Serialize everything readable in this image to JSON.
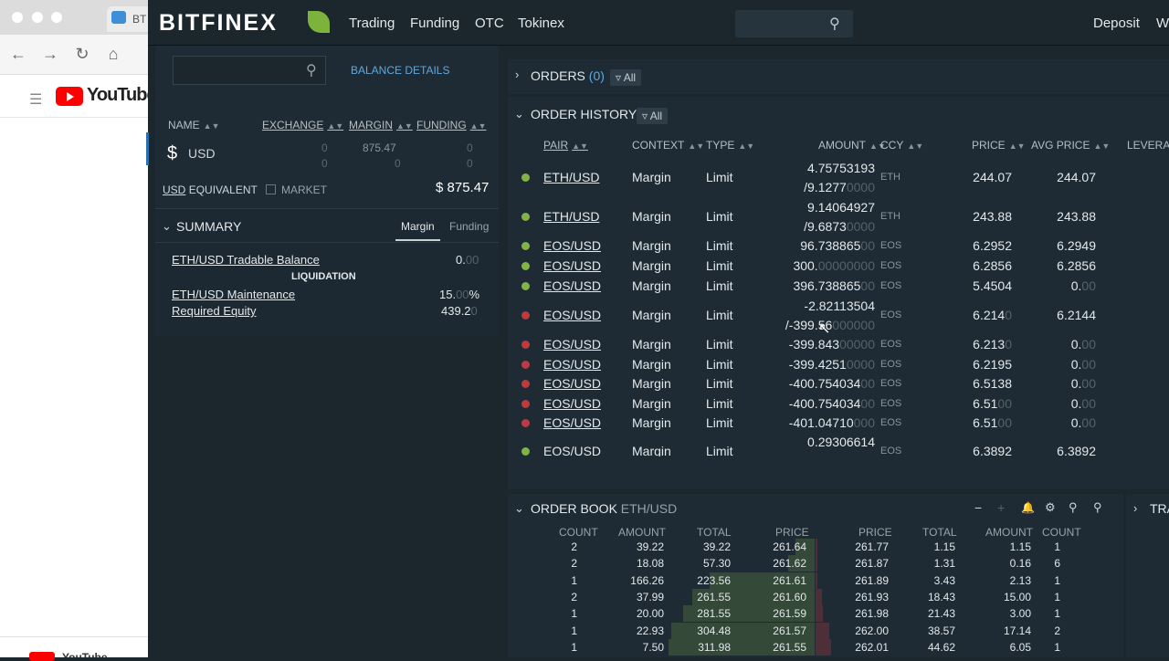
{
  "browser": {
    "tab_title": "BT",
    "youtube_word": "YouTube",
    "dock_label": "YouTube"
  },
  "nav": {
    "brand": "BITFINEX",
    "items": [
      "Trading",
      "Funding",
      "OTC",
      "Tokinex"
    ],
    "deposit": "Deposit",
    "w": "W"
  },
  "balance": {
    "details_link": "BALANCE DETAILS",
    "columns": [
      "NAME",
      "EXCHANGE",
      "MARGIN",
      "FUNDING"
    ],
    "row": {
      "symbol": "$",
      "currency": "USD",
      "exchange_top": "0",
      "exchange_bottom": "0",
      "margin_top": "875.47",
      "margin_bottom": "0",
      "funding_top": "0",
      "funding_bottom": "0"
    },
    "equivalent_currency": "USD",
    "equivalent_label": "EQUIVALENT",
    "market_label": "MARKET",
    "total": "$ 875.47"
  },
  "summary": {
    "title": "SUMMARY",
    "tabs": [
      "Margin",
      "Funding"
    ],
    "tradable_label": "ETH/USD Tradable Balance",
    "tradable_value": "0.",
    "tradable_dim": "00",
    "liquidation": "LIQUIDATION",
    "maint_label_1": "ETH/USD Maintenance",
    "maint_label_2": "Required Equity",
    "maint_value": "15.",
    "maint_dim": "00",
    "maint_pct": "%",
    "req_value": "439.2",
    "req_dim": "0"
  },
  "orders": {
    "title": "ORDERS",
    "count": "(0)",
    "filter": "All"
  },
  "order_history": {
    "title": "ORDER HISTORY",
    "filter": "All",
    "columns": [
      "PAIR",
      "CONTEXT",
      "TYPE",
      "AMOUNT",
      "CCY",
      "PRICE",
      "AVG PRICE",
      "LEVERAG"
    ],
    "rows": [
      {
        "status": "filled",
        "pair": "ETH/USD",
        "context": "Margin",
        "type": "Limit",
        "amount": "4.75753193",
        "amount2": "/9.1277",
        "amount2_dim": "0000",
        "ccy": "ETH",
        "price": "244.07",
        "price_dim": "",
        "avg": "244.07",
        "avg_dim": ""
      },
      {
        "status": "filled",
        "pair": "ETH/USD",
        "context": "Margin",
        "type": "Limit",
        "amount": "9.14064927",
        "amount2": "/9.6873",
        "amount2_dim": "0000",
        "ccy": "ETH",
        "price": "243.88",
        "price_dim": "",
        "avg": "243.88",
        "avg_dim": ""
      },
      {
        "status": "filled",
        "pair": "EOS/USD",
        "context": "Margin",
        "type": "Limit",
        "amount": "96.738865",
        "amount_dim": "00",
        "ccy": "EOS",
        "price": "6.2952",
        "price_dim": "",
        "avg": "6.2949",
        "avg_dim": ""
      },
      {
        "status": "filled",
        "pair": "EOS/USD",
        "context": "Margin",
        "type": "Limit",
        "amount": "300.",
        "amount_dim": "00000000",
        "ccy": "EOS",
        "price": "6.2856",
        "price_dim": "",
        "avg": "6.2856",
        "avg_dim": ""
      },
      {
        "status": "filled",
        "pair": "EOS/USD",
        "context": "Margin",
        "type": "Limit",
        "amount": "396.738865",
        "amount_dim": "00",
        "ccy": "EOS",
        "price": "5.4504",
        "price_dim": "",
        "avg": "0.",
        "avg_dim": "00"
      },
      {
        "status": "canceled",
        "pair": "EOS/USD",
        "context": "Margin",
        "type": "Limit",
        "amount": "-2.82113504",
        "amount2": "/-399.56",
        "amount2_dim": "000000",
        "ccy": "EOS",
        "price": "6.214",
        "price_dim": "0",
        "avg": "6.2144",
        "avg_dim": ""
      },
      {
        "status": "canceled",
        "pair": "EOS/USD",
        "context": "Margin",
        "type": "Limit",
        "amount": "-399.843",
        "amount_dim": "00000",
        "ccy": "EOS",
        "price": "6.213",
        "price_dim": "0",
        "avg": "0.",
        "avg_dim": "00"
      },
      {
        "status": "canceled",
        "pair": "EOS/USD",
        "context": "Margin",
        "type": "Limit",
        "amount": "-399.4251",
        "amount_dim": "0000",
        "ccy": "EOS",
        "price": "6.2195",
        "price_dim": "",
        "avg": "0.",
        "avg_dim": "00"
      },
      {
        "status": "canceled",
        "pair": "EOS/USD",
        "context": "Margin",
        "type": "Limit",
        "amount": "-400.754034",
        "amount_dim": "00",
        "ccy": "EOS",
        "price": "6.5138",
        "price_dim": "",
        "avg": "0.",
        "avg_dim": "00"
      },
      {
        "status": "canceled",
        "pair": "EOS/USD",
        "context": "Margin",
        "type": "Limit",
        "amount": "-400.754034",
        "amount_dim": "00",
        "ccy": "EOS",
        "price": "6.51",
        "price_dim": "00",
        "avg": "0.",
        "avg_dim": "00"
      },
      {
        "status": "canceled",
        "pair": "EOS/USD",
        "context": "Margin",
        "type": "Limit",
        "amount": "-401.04710",
        "amount_dim": "000",
        "ccy": "EOS",
        "price": "6.51",
        "price_dim": "00",
        "avg": "0.",
        "avg_dim": "00"
      },
      {
        "status": "filled",
        "pair": "EOS/USD",
        "context": "Margin",
        "type": "Limit",
        "amount": "0.29306614",
        "amount_dim": "",
        "ccy": "EOS",
        "price": "6.3892",
        "price_dim": "",
        "avg": "6.3892",
        "avg_dim": ""
      }
    ]
  },
  "order_book": {
    "title": "ORDER BOOK",
    "pair": "ETH/USD",
    "bid_columns": [
      "COUNT",
      "AMOUNT",
      "TOTAL",
      "PRICE"
    ],
    "ask_columns": [
      "PRICE",
      "TOTAL",
      "AMOUNT",
      "COUNT"
    ],
    "bids": [
      {
        "count": "2",
        "amount": "39.22",
        "total": "39.22",
        "price": "261.64",
        "depth": 0.13
      },
      {
        "count": "2",
        "amount": "18.08",
        "total": "57.30",
        "price": "261.62",
        "depth": 0.18
      },
      {
        "count": "1",
        "amount": "166.26",
        "total": "223.56",
        "price": "261.61",
        "depth": 0.72
      },
      {
        "count": "2",
        "amount": "37.99",
        "total": "261.55",
        "price": "261.60",
        "depth": 0.84
      },
      {
        "count": "1",
        "amount": "20.00",
        "total": "281.55",
        "price": "261.59",
        "depth": 0.9
      },
      {
        "count": "1",
        "amount": "22.93",
        "total": "304.48",
        "price": "261.57",
        "depth": 0.98
      },
      {
        "count": "1",
        "amount": "7.50",
        "total": "311.98",
        "price": "261.55",
        "depth": 1.0
      }
    ],
    "asks": [
      {
        "price": "261.77",
        "total": "1.15",
        "amount": "1.15",
        "count": "1",
        "depth": 0.02
      },
      {
        "price": "261.87",
        "total": "1.31",
        "amount": "0.16",
        "count": "6",
        "depth": 0.03
      },
      {
        "price": "261.89",
        "total": "3.43",
        "amount": "2.13",
        "count": "1",
        "depth": 0.07
      },
      {
        "price": "261.93",
        "total": "18.43",
        "amount": "15.00",
        "count": "1",
        "depth": 0.36
      },
      {
        "price": "261.98",
        "total": "21.43",
        "amount": "3.00",
        "count": "1",
        "depth": 0.42
      },
      {
        "price": "262.00",
        "total": "38.57",
        "amount": "17.14",
        "count": "2",
        "depth": 0.75
      },
      {
        "price": "262.01",
        "total": "44.62",
        "amount": "6.05",
        "count": "1",
        "depth": 0.87
      }
    ]
  },
  "trades": {
    "title": "TRA"
  },
  "colors": {
    "bg": "#1b262d",
    "panel": "#1e2b34",
    "green": "#82b445",
    "red": "#c0393e",
    "accent": "#5ea8e0"
  }
}
